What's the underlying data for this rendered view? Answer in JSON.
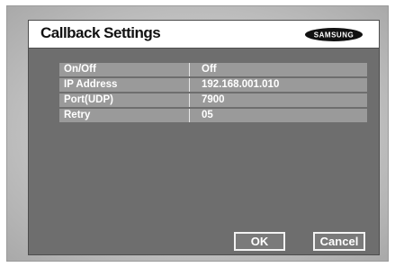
{
  "dialog": {
    "title": "Callback Settings",
    "brand_logo_text": "SAMSUNG"
  },
  "settings": {
    "rows": [
      {
        "label": "On/Off",
        "value": "Off"
      },
      {
        "label": "IP Address",
        "value": "192.168.001.010"
      },
      {
        "label": "Port(UDP)",
        "value": "7900"
      },
      {
        "label": "Retry",
        "value": "05"
      }
    ]
  },
  "buttons": {
    "ok_label": "OK",
    "cancel_label": "Cancel"
  },
  "colors": {
    "panel_bg": "#6e6e6e",
    "row_bg": "#9a9a9a",
    "title_bar_bg": "#ffffff"
  }
}
